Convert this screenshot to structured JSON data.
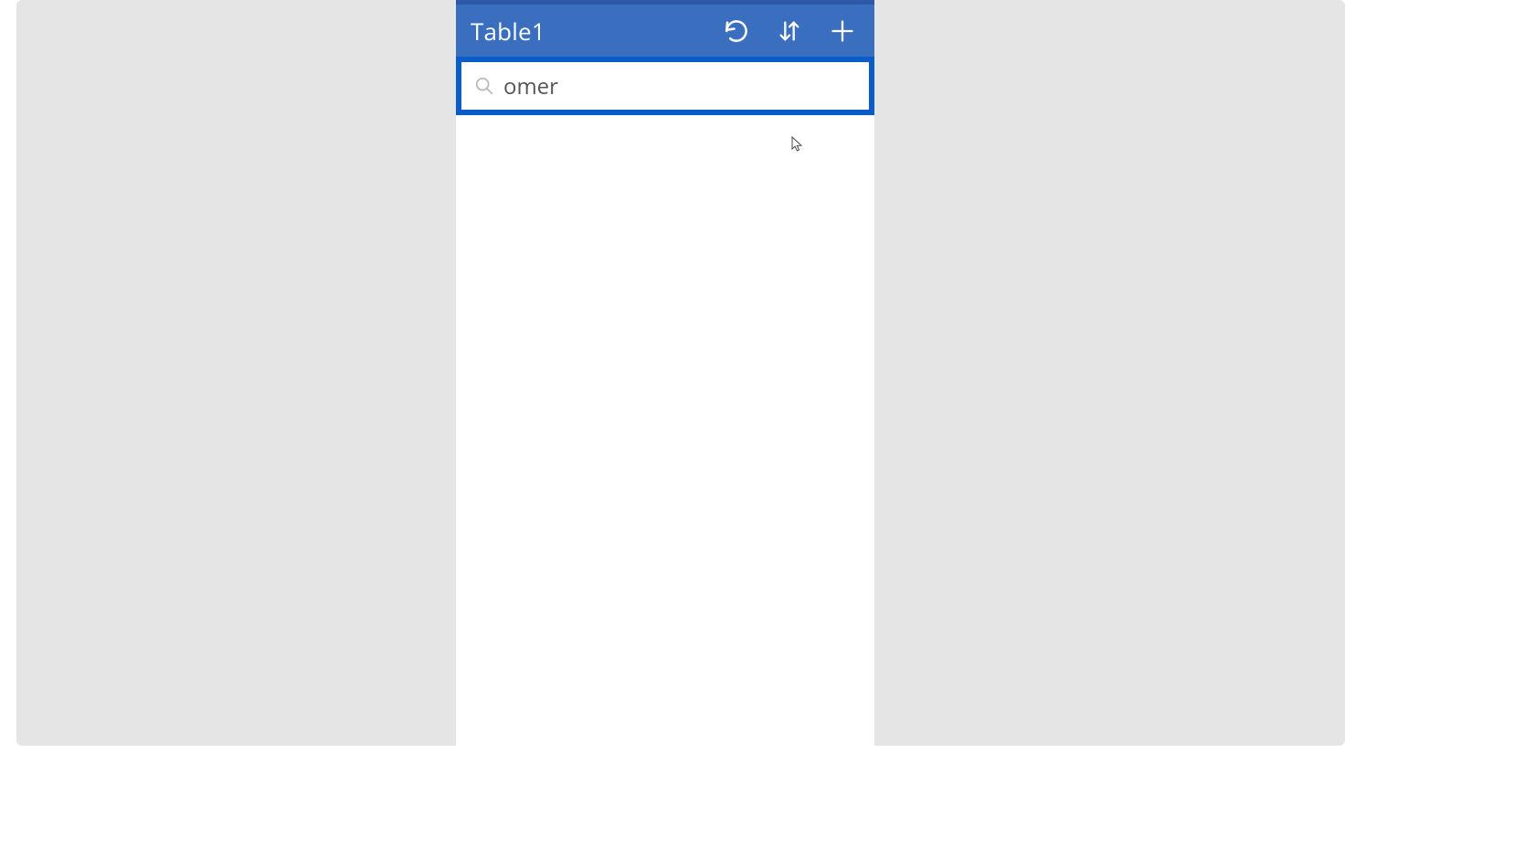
{
  "colors": {
    "header_bg": "#3a6fc0",
    "header_top_border": "#2d5aa8",
    "focus_ring": "#0a5cc9",
    "backdrop": "#e5e5e5"
  },
  "header": {
    "title": "Table1",
    "icons": {
      "refresh": "refresh-icon",
      "sort": "sort-icon",
      "add": "plus-icon"
    }
  },
  "search": {
    "value": "omer",
    "placeholder": ""
  }
}
